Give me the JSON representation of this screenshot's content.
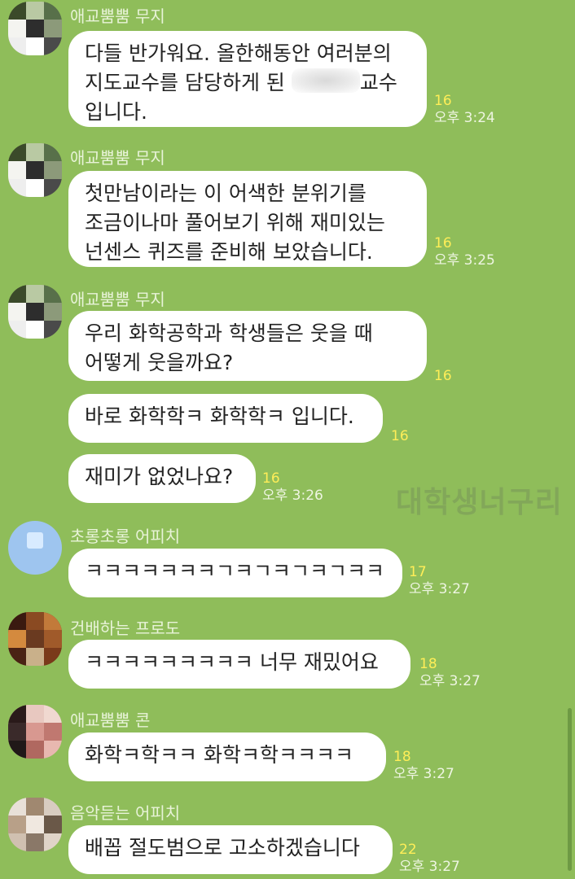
{
  "chat": {
    "messages": [
      {
        "sender": "애교뿜뿜 무지",
        "lines": [
          "다들 반가워요. 올한해동안 여러분의",
          "지도교수를 담당하게 된",
          "입니다."
        ],
        "redacted_suffix": "교수",
        "count": "16",
        "time": "오후 3:24"
      },
      {
        "sender": "애교뿜뿜 무지",
        "lines": [
          "첫만남이라는 이 어색한 분위기를",
          "조금이나마 풀어보기 위해 재미있는",
          "넌센스 퀴즈를 준비해 보았습니다."
        ],
        "count": "16",
        "time": "오후 3:25"
      },
      {
        "sender": "애교뿜뿜 무지",
        "lines": [
          "우리 화학공학과 학생들은 웃을 때",
          "어떻게 웃을까요?"
        ],
        "count": "16",
        "time": ""
      },
      {
        "sender": "",
        "lines": [
          "바로 화학학ㅋ 화학학ㅋ 입니다."
        ],
        "count": "16",
        "time": ""
      },
      {
        "sender": "",
        "lines": [
          "재미가 없었나요?"
        ],
        "count": "16",
        "time": "오후 3:26"
      },
      {
        "sender": "초롱초롱 어피치",
        "lines": [
          "ㅋㅋㅋㅋㅋㅋㅋㄱㅋㄱㅋㄱㅋㄱㅋㅋ"
        ],
        "count": "17",
        "time": "오후 3:27"
      },
      {
        "sender": "건배하는 프로도",
        "lines": [
          "ㅋㅋㅋㅋㅋㅋㅋㅋㅋ 너무 재밌어요"
        ],
        "count": "18",
        "time": "오후 3:27"
      },
      {
        "sender": "애교뿜뿜 콘",
        "lines": [
          "화학ㅋ학ㅋㅋ 화학ㅋ학ㅋㅋㅋㅋ"
        ],
        "count": "18",
        "time": "오후 3:27"
      },
      {
        "sender": "음악듣는 어피치",
        "lines": [
          "배꼽 절도범으로 고소하겠습니다"
        ],
        "count": "22",
        "time": "오후 3:27"
      }
    ]
  },
  "watermark": "대학생너구리",
  "colors": {
    "background": "#8fbd5a",
    "bubble": "#ffffff",
    "unread_count": "#ffee58"
  }
}
